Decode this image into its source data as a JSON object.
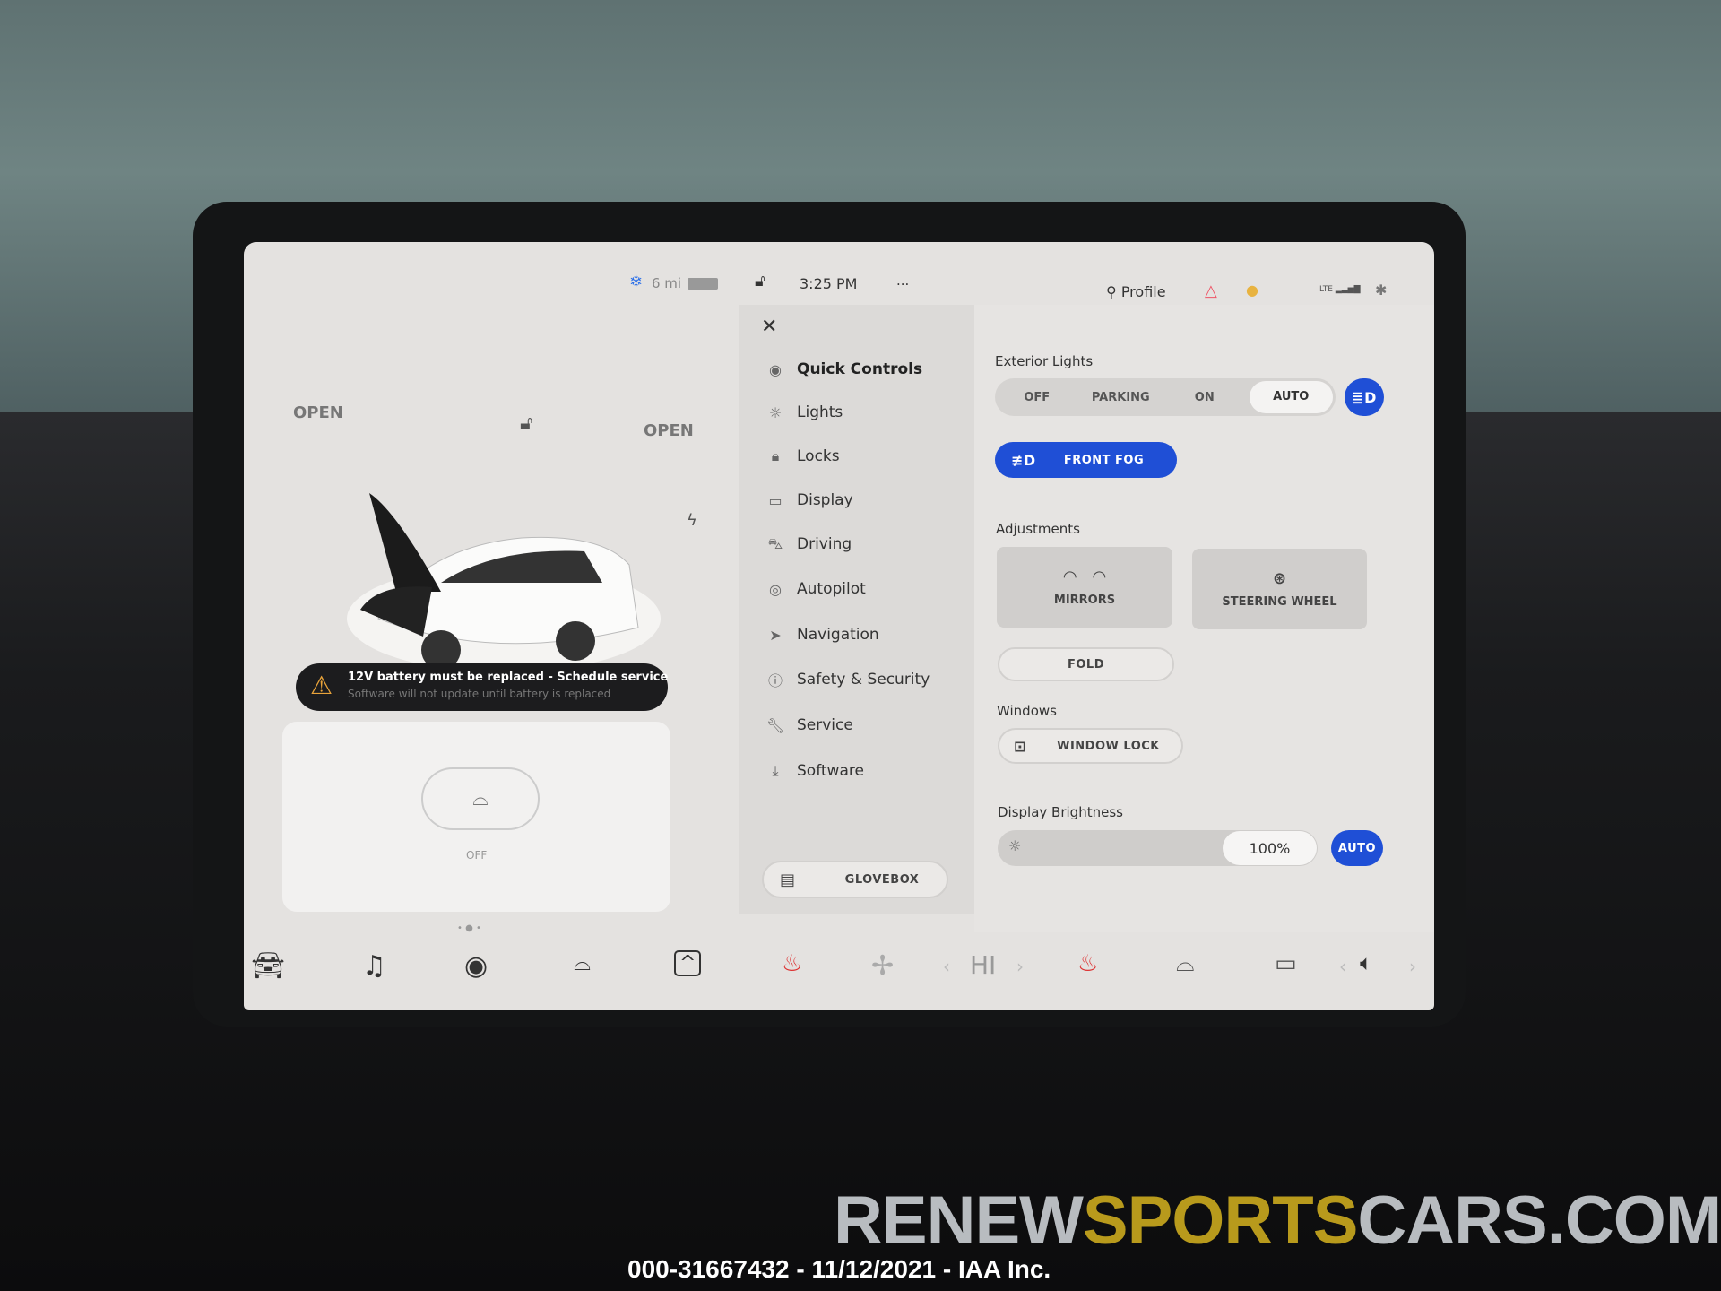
{
  "status_bar": {
    "range": "6 mi",
    "time": "3:25 PM",
    "more": "...",
    "profile": "Profile",
    "lte": "LTE"
  },
  "car": {
    "frunk_status": "OPEN",
    "trunk_status": "OPEN"
  },
  "alert": {
    "title": "12V battery must be replaced - Schedule service",
    "subtitle": "Software will not update until battery is replaced"
  },
  "wiper": {
    "state": "OFF"
  },
  "menu": {
    "items": [
      {
        "label": "Quick Controls",
        "icon": "eye-icon"
      },
      {
        "label": "Lights",
        "icon": "sun-icon"
      },
      {
        "label": "Locks",
        "icon": "lock-icon"
      },
      {
        "label": "Display",
        "icon": "display-icon"
      },
      {
        "label": "Driving",
        "icon": "car-icon"
      },
      {
        "label": "Autopilot",
        "icon": "steering-icon"
      },
      {
        "label": "Navigation",
        "icon": "navigation-icon"
      },
      {
        "label": "Safety & Security",
        "icon": "info-icon"
      },
      {
        "label": "Service",
        "icon": "wrench-icon"
      },
      {
        "label": "Software",
        "icon": "download-icon"
      }
    ],
    "glovebox": "GLOVEBOX"
  },
  "controls": {
    "exterior_lights": {
      "label": "Exterior Lights",
      "options": [
        "OFF",
        "PARKING",
        "ON",
        "AUTO"
      ],
      "selected": "AUTO"
    },
    "front_fog": "FRONT FOG",
    "adjustments": {
      "label": "Adjustments",
      "mirrors": "MIRRORS",
      "steering": "STEERING WHEEL",
      "fold": "FOLD"
    },
    "windows": {
      "label": "Windows",
      "window_lock": "WINDOW LOCK"
    },
    "brightness": {
      "label": "Display Brightness",
      "value": "100%",
      "auto": "AUTO",
      "level": 100
    }
  },
  "bottom_bar": {
    "fan_speed": "HI"
  },
  "accent": "#1f4fd6",
  "watermark": {
    "part1": "RENEW",
    "part2": "SPORTS",
    "part3": "CARS.COM",
    "caption": "000-31667432 - 11/12/2021 - IAA Inc."
  }
}
